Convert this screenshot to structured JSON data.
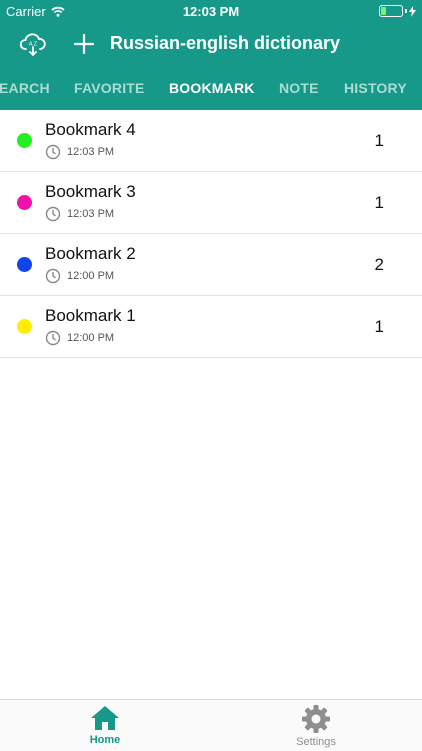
{
  "status_bar": {
    "carrier": "Carrier",
    "time": "12:03 PM"
  },
  "app_bar": {
    "title": "Russian-english dictionary",
    "icons": [
      "cloud-download-icon",
      "plus-icon"
    ]
  },
  "tabs": [
    {
      "label": "EARCH",
      "active": false
    },
    {
      "label": "FAVORITE",
      "active": false
    },
    {
      "label": "BOOKMARK",
      "active": true
    },
    {
      "label": "NOTE",
      "active": false
    },
    {
      "label": "HISTORY",
      "active": false
    }
  ],
  "bookmarks": [
    {
      "title": "Bookmark 4",
      "time": "12:03 PM",
      "count": "1",
      "color": "#22ee22"
    },
    {
      "title": "Bookmark 3",
      "time": "12:03 PM",
      "count": "1",
      "color": "#ee11aa"
    },
    {
      "title": "Bookmark 2",
      "time": "12:00 PM",
      "count": "2",
      "color": "#1144ee"
    },
    {
      "title": "Bookmark 1",
      "time": "12:00 PM",
      "count": "1",
      "color": "#ffee00"
    }
  ],
  "bottom_nav": {
    "home": {
      "label": "Home",
      "icon": "home-icon",
      "active": true
    },
    "settings": {
      "label": "Settings",
      "icon": "gear-icon",
      "active": false
    }
  },
  "colors": {
    "primary": "#17998a",
    "tab_inactive": "#a8dcd4",
    "divider": "#e4e4e4"
  }
}
